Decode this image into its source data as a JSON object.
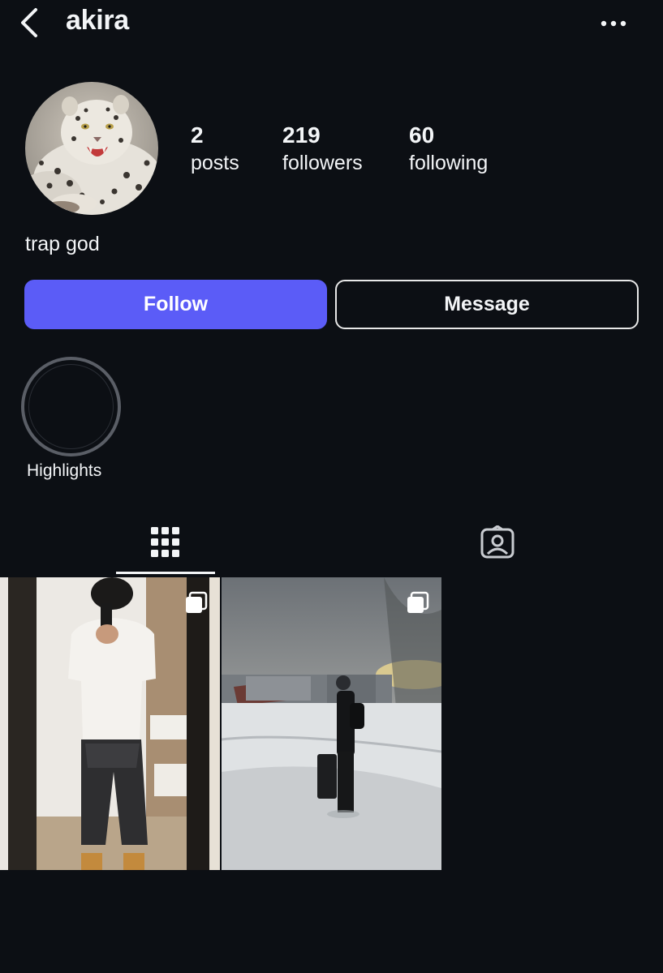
{
  "header": {
    "username": "akira"
  },
  "profile": {
    "stats": [
      {
        "value": "2",
        "label": "posts"
      },
      {
        "value": "219",
        "label": "followers"
      },
      {
        "value": "60",
        "label": "following"
      }
    ],
    "bio": "trap god"
  },
  "actions": {
    "follow_label": "Follow",
    "message_label": "Message"
  },
  "highlights": [
    {
      "label": "Highlights"
    }
  ],
  "tabs": [
    {
      "icon": "grid-icon",
      "active": true
    },
    {
      "icon": "tagged-icon",
      "active": false
    }
  ],
  "posts": [
    {
      "type": "carousel",
      "scene": "mirror-selfie"
    },
    {
      "type": "carousel",
      "scene": "snowy-street"
    }
  ],
  "colors": {
    "background": "#0c0f14",
    "accent": "#5b5cf7",
    "text": "#f3f5f7"
  }
}
